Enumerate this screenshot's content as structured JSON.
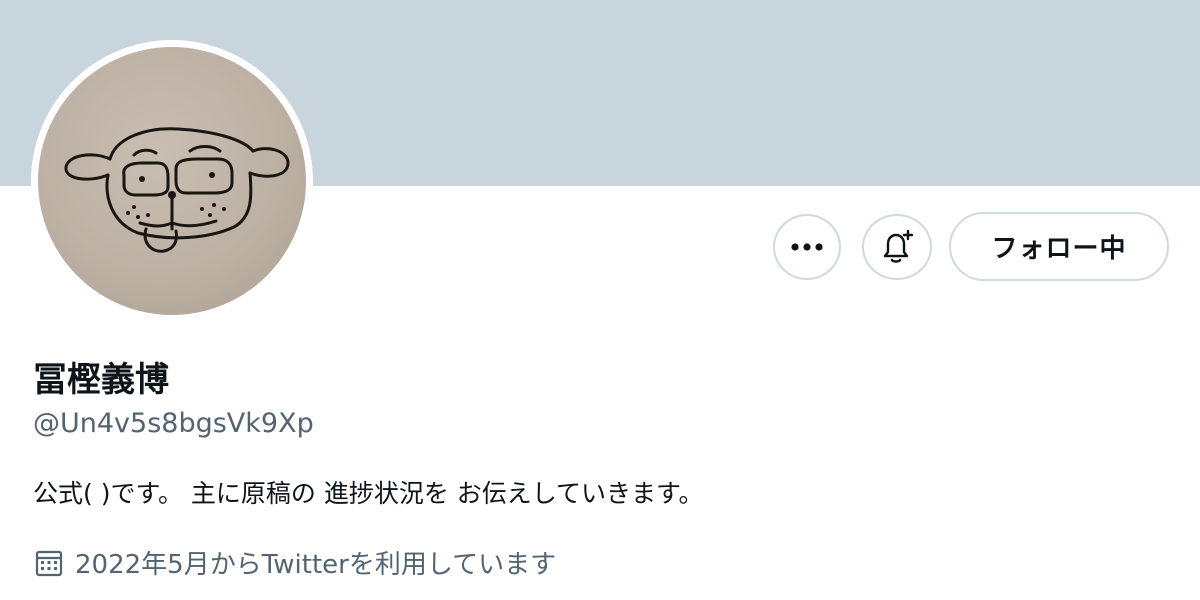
{
  "profile": {
    "display_name": "冨樫義博",
    "handle": "@Un4v5s8bgsVk9Xp",
    "bio": "公式( )です。 主に原稿の 進捗状況を お伝えしていきます。",
    "joined": "2022年5月からTwitterを利用しています"
  },
  "actions": {
    "follow_label": "フォロー中",
    "more_icon": "more-icon",
    "bell_icon": "notification-bell-icon"
  },
  "colors": {
    "banner": "#c9d5dc",
    "button_border": "#cfd9de",
    "text_primary": "#0f1419",
    "text_secondary": "#536471"
  }
}
